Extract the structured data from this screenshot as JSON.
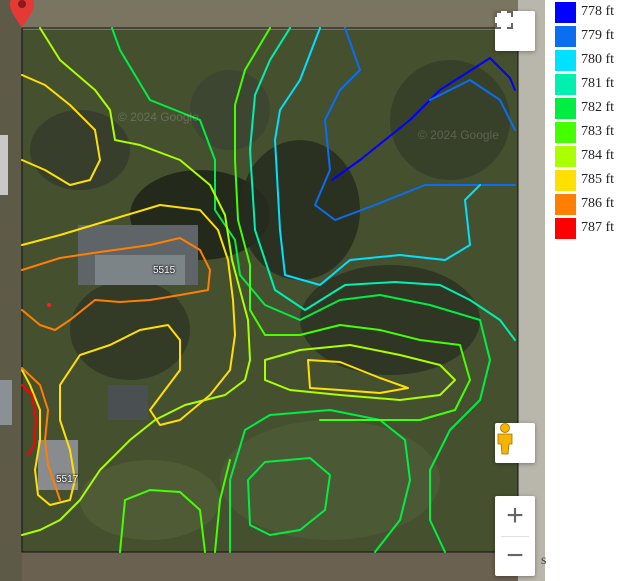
{
  "map": {
    "house_labels": [
      "5515",
      "5517"
    ],
    "watermarks": [
      "© 2024 Google",
      "© 2024 Google"
    ],
    "controls": {
      "fullscreen_icon": "fullscreen-icon",
      "pegman_icon": "pegman-icon",
      "zoom_in": "+",
      "zoom_out": "−"
    },
    "marker_color": "#e53935",
    "side_glyph": "s"
  },
  "legend": {
    "items": [
      {
        "label": "778 ft",
        "color": "#0000ff"
      },
      {
        "label": "779 ft",
        "color": "#0a6ef0"
      },
      {
        "label": "780 ft",
        "color": "#00e0ff"
      },
      {
        "label": "781 ft",
        "color": "#00f0b0"
      },
      {
        "label": "782 ft",
        "color": "#00ee44"
      },
      {
        "label": "783 ft",
        "color": "#44ff00"
      },
      {
        "label": "784 ft",
        "color": "#aaff00"
      },
      {
        "label": "785 ft",
        "color": "#ffe000"
      },
      {
        "label": "786 ft",
        "color": "#ff7f00"
      },
      {
        "label": "787 ft",
        "color": "#ff0000"
      }
    ]
  }
}
